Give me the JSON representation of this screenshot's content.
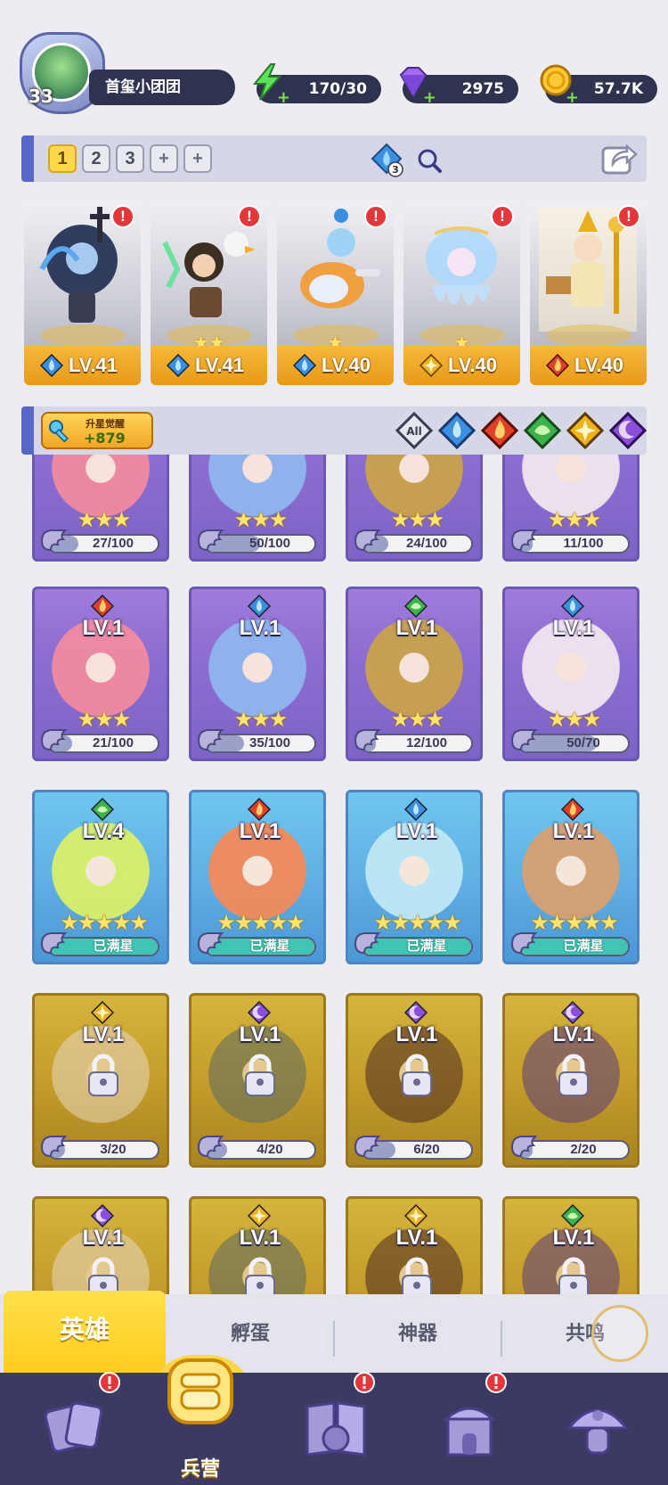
{
  "player": {
    "level": "33",
    "name": "首玺小团团"
  },
  "resources": {
    "energy": "170/30",
    "gems": "2975",
    "gold": "57.7K"
  },
  "team_tabs": [
    "1",
    "2",
    "3",
    "+",
    "+"
  ],
  "team_badge": "3",
  "lineup": [
    {
      "level": "LV.41",
      "element": "water",
      "stars": 0,
      "alert": "!"
    },
    {
      "level": "LV.41",
      "element": "water",
      "stars": 2,
      "alert": "!"
    },
    {
      "level": "LV.40",
      "element": "water",
      "stars": 1,
      "alert": "!"
    },
    {
      "level": "LV.40",
      "element": "light",
      "stars": 1,
      "alert": "!"
    },
    {
      "level": "LV.40",
      "element": "fire",
      "stars": 0,
      "alert": "!"
    }
  ],
  "star_up": {
    "label": "升星觉醒",
    "value": "+879"
  },
  "filters": [
    "All",
    "water",
    "fire",
    "nature",
    "light",
    "dark"
  ],
  "filter_all_label": "All",
  "heroes": [
    {
      "variant": "purple",
      "level": "",
      "element": "",
      "stars": "★★★",
      "progress_text": "27/100",
      "progress": 0.27,
      "partial": true
    },
    {
      "variant": "purple",
      "level": "",
      "element": "",
      "stars": "★★★",
      "progress_text": "50/100",
      "progress": 0.5,
      "partial": true
    },
    {
      "variant": "purple",
      "level": "",
      "element": "",
      "stars": "★★★",
      "progress_text": "24/100",
      "progress": 0.24,
      "partial": true
    },
    {
      "variant": "purple",
      "level": "",
      "element": "",
      "stars": "★★★",
      "progress_text": "11/100",
      "progress": 0.11,
      "partial": true
    },
    {
      "variant": "purple",
      "level": "LV.1",
      "element": "fire",
      "stars": "★★★",
      "progress_text": "21/100",
      "progress": 0.21
    },
    {
      "variant": "purple",
      "level": "LV.1",
      "element": "water",
      "stars": "★★★",
      "progress_text": "35/100",
      "progress": 0.35
    },
    {
      "variant": "purple",
      "level": "LV.1",
      "element": "nature",
      "stars": "★★★",
      "progress_text": "12/100",
      "progress": 0.12
    },
    {
      "variant": "purple",
      "level": "LV.1",
      "element": "water",
      "stars": "★★★",
      "progress_text": "50/70",
      "progress": 0.714
    },
    {
      "variant": "blue",
      "level": "LV.4",
      "element": "nature",
      "stars": "★★★★★",
      "progress_text": "已满星",
      "progress": 1,
      "full": true
    },
    {
      "variant": "blue",
      "level": "LV.1",
      "element": "fire",
      "stars": "★★★★★",
      "progress_text": "已满星",
      "progress": 1,
      "full": true
    },
    {
      "variant": "blue",
      "level": "LV.1",
      "element": "water",
      "stars": "★★★★★",
      "progress_text": "已满星",
      "progress": 1,
      "full": true
    },
    {
      "variant": "blue",
      "level": "LV.1",
      "element": "fire",
      "stars": "★★★★★",
      "progress_text": "已满星",
      "progress": 1,
      "full": true
    },
    {
      "variant": "gold",
      "level": "LV.1",
      "element": "light",
      "stars": "",
      "progress_text": "3/20",
      "progress": 0.15,
      "locked": true
    },
    {
      "variant": "gold",
      "level": "LV.1",
      "element": "dark",
      "stars": "",
      "progress_text": "4/20",
      "progress": 0.2,
      "locked": true
    },
    {
      "variant": "gold",
      "level": "LV.1",
      "element": "dark",
      "stars": "",
      "progress_text": "6/20",
      "progress": 0.3,
      "locked": true
    },
    {
      "variant": "gold",
      "level": "LV.1",
      "element": "dark",
      "stars": "",
      "progress_text": "2/20",
      "progress": 0.1,
      "locked": true
    },
    {
      "variant": "gold",
      "level": "LV.1",
      "element": "dark",
      "stars": "",
      "progress_text": "",
      "progress": 0,
      "locked": true,
      "cut": true
    },
    {
      "variant": "gold",
      "level": "LV.1",
      "element": "light",
      "stars": "",
      "progress_text": "",
      "progress": 0,
      "locked": true,
      "cut": true
    },
    {
      "variant": "gold",
      "level": "LV.1",
      "element": "light",
      "stars": "",
      "progress_text": "",
      "progress": 0,
      "locked": true,
      "cut": true
    },
    {
      "variant": "gold",
      "level": "LV.1",
      "element": "nature",
      "stars": "",
      "progress_text": "",
      "progress": 0,
      "locked": true,
      "cut": true
    }
  ],
  "subtabs": [
    "英雄",
    "孵蛋",
    "神器",
    "共鸣"
  ],
  "bottom_nav": {
    "active_label": "兵营",
    "alert": "!"
  },
  "colors": {
    "water": "#3b8fe0",
    "fire": "#e0402a",
    "nature": "#3cb34a",
    "light": "#f0b21a",
    "dark": "#8a4fd8"
  }
}
